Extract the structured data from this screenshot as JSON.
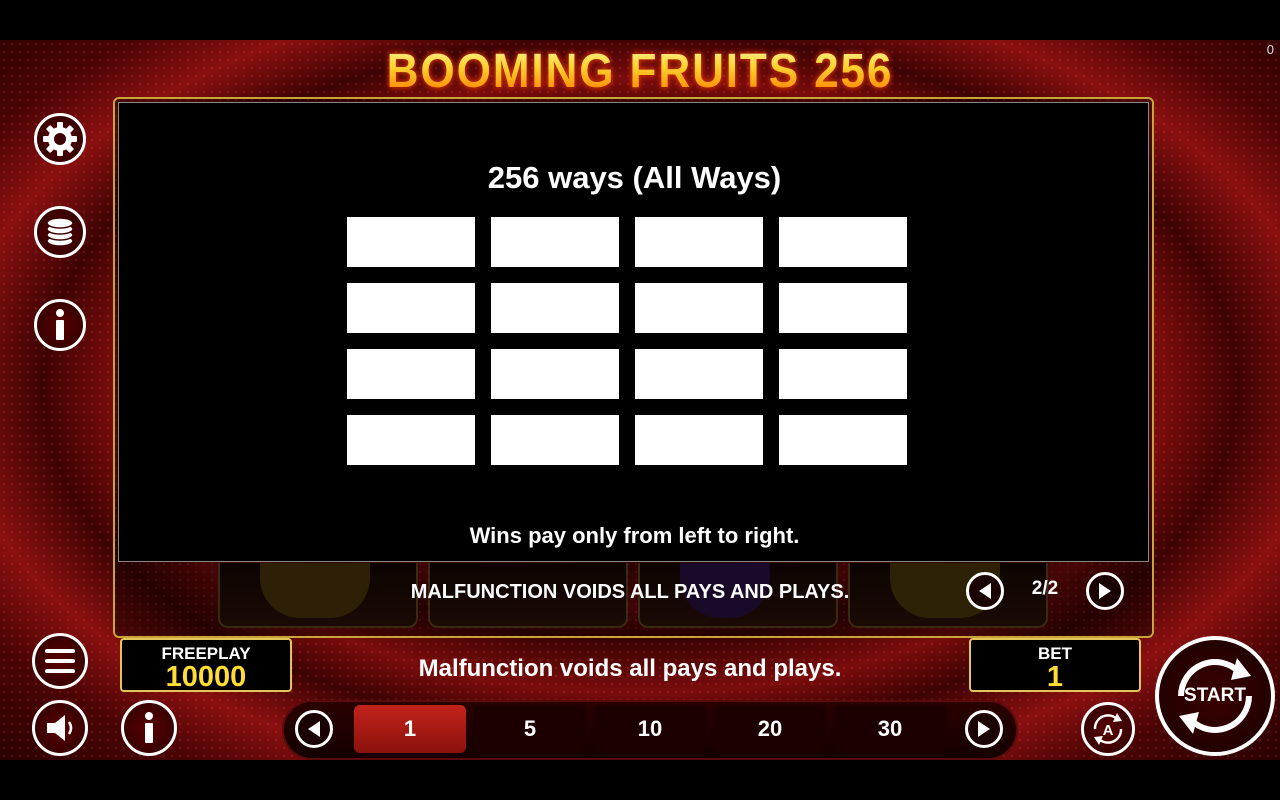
{
  "header": {
    "game_title": "BOOMING FRUITS 256",
    "corner_counter": "0"
  },
  "side_menu": {
    "settings_icon": "gear-icon",
    "coins_icon": "coin-stack-icon",
    "info_icon": "info-icon",
    "menu_icon": "hamburger-menu-icon",
    "sound_icon": "speaker-icon"
  },
  "paytable": {
    "title": "256 ways (All Ways)",
    "grid": {
      "rows": 4,
      "columns": 4
    },
    "rule_text": "Wins pay only from left to right.",
    "footer_notice": "MALFUNCTION VOIDS ALL PAYS AND PLAYS.",
    "page_indicator": "2/2"
  },
  "bottom_bar": {
    "balance_label": "FREEPLAY",
    "balance_value": "10000",
    "status_message": "Malfunction voids all pays and plays.",
    "bet_label": "BET",
    "bet_value": "1",
    "bet_options": [
      "1",
      "5",
      "10",
      "20",
      "30"
    ],
    "selected_bet": "1",
    "start_label": "START",
    "autoplay_icon": "autoplay-icon"
  },
  "colors": {
    "accent_gold": "#e3c55a",
    "value_yellow": "#ffdd33",
    "selected_bet": "#c2231b",
    "background_red": "#7a0c0c"
  }
}
